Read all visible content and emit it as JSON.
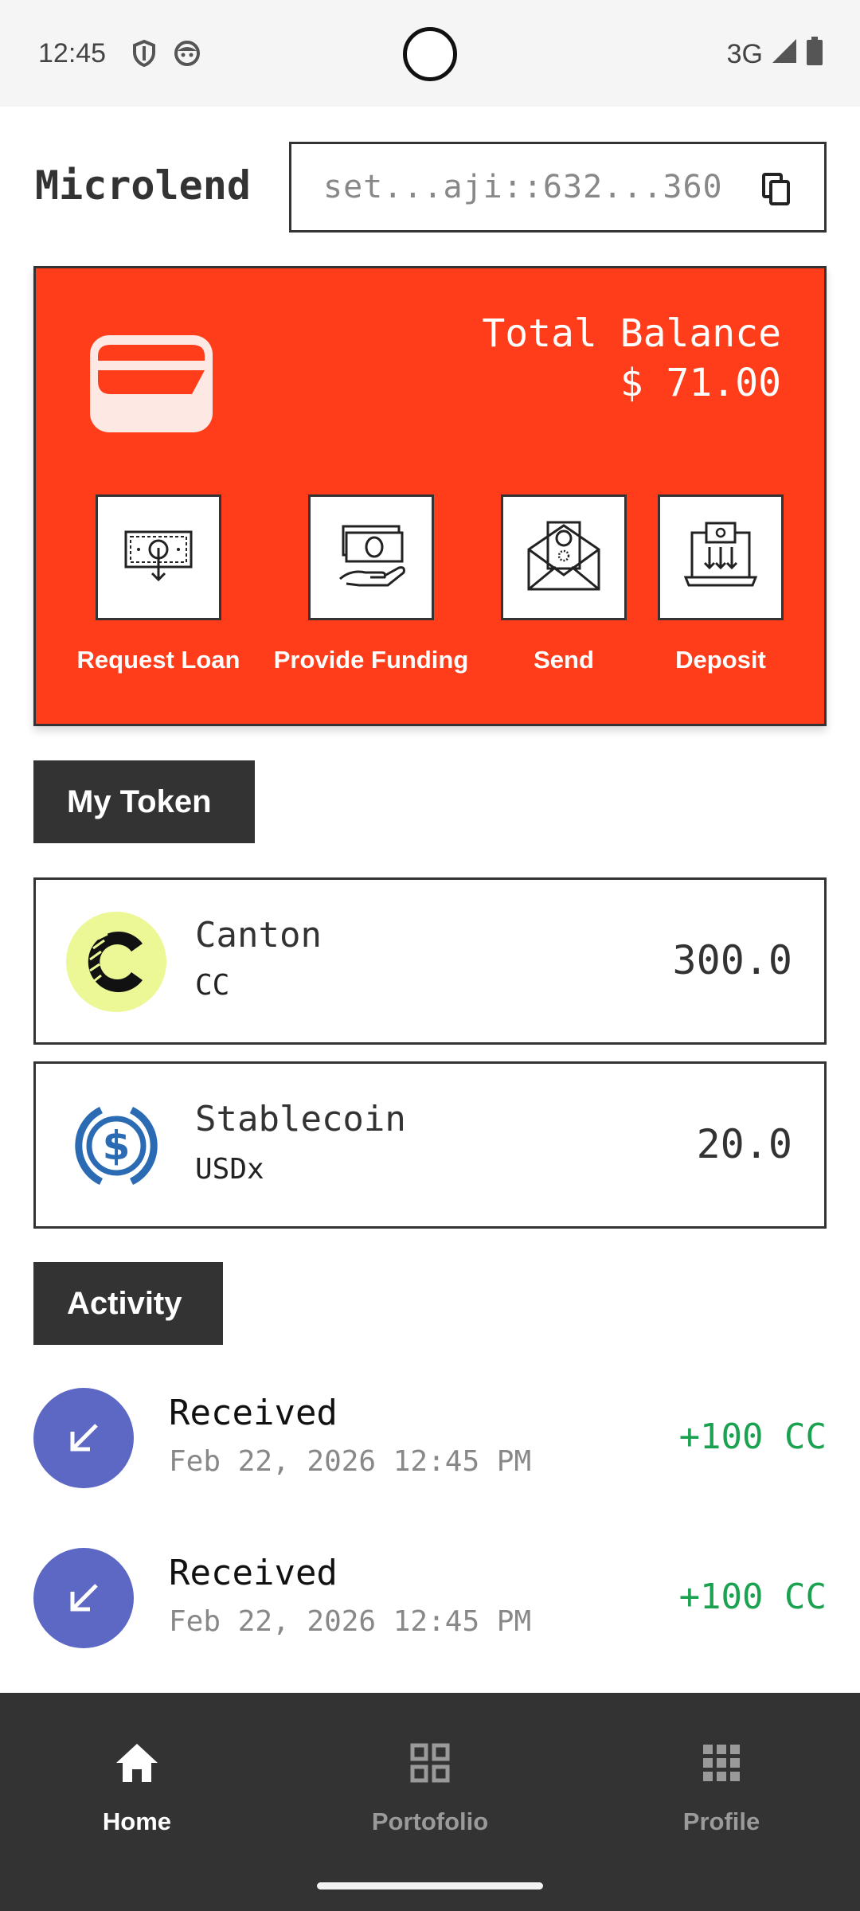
{
  "status_bar": {
    "time": "12:45",
    "network": "3G"
  },
  "header": {
    "title": "Microlend",
    "address": "set...aji::632...360"
  },
  "balance": {
    "label": "Total Balance",
    "amount": "$ 71.00"
  },
  "actions": [
    {
      "label": "Request Loan"
    },
    {
      "label": "Provide Funding"
    },
    {
      "label": "Send"
    },
    {
      "label": "Deposit"
    }
  ],
  "tokens": {
    "heading": "My Token",
    "items": [
      {
        "name": "Canton",
        "symbol": "CC",
        "amount": "300.0"
      },
      {
        "name": "Stablecoin",
        "symbol": "USDx",
        "amount": "20.0"
      }
    ]
  },
  "activity": {
    "heading": "Activity",
    "items": [
      {
        "title": "Received",
        "date": "Feb 22, 2026 12:45 PM",
        "amount": "+100 CC"
      },
      {
        "title": "Received",
        "date": "Feb 22, 2026 12:45 PM",
        "amount": "+100 CC"
      }
    ]
  },
  "nav": {
    "items": [
      {
        "label": "Home",
        "active": true
      },
      {
        "label": "Portofolio",
        "active": false
      },
      {
        "label": "Profile",
        "active": false
      }
    ]
  },
  "colors": {
    "accent": "#ff3d1a",
    "dark": "#333333",
    "positive": "#1aa251",
    "activity_icon": "#5c68c4"
  }
}
